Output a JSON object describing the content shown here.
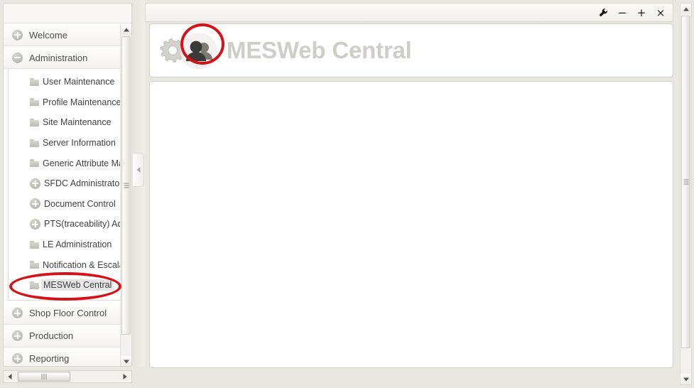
{
  "window": {
    "controls": [
      {
        "name": "wrench-icon",
        "glyph": "⚒"
      },
      {
        "name": "minimize-button",
        "glyph": "−"
      },
      {
        "name": "maximize-button",
        "glyph": "+"
      },
      {
        "name": "close-button",
        "glyph": "×"
      }
    ]
  },
  "header": {
    "title": "MESWeb Central",
    "gear_icon": "gear-icon",
    "users_icon": "users-icon"
  },
  "sidebar": {
    "groups": [
      {
        "label": "Welcome",
        "state": "collapsed",
        "icon": "plus-circle-icon",
        "items": []
      },
      {
        "label": "Administration",
        "state": "expanded",
        "icon": "minus-circle-icon",
        "items": [
          {
            "label": "User Maintenance",
            "icon": "folder-icon",
            "selected": false
          },
          {
            "label": "Profile Maintenance",
            "icon": "folder-icon",
            "selected": false
          },
          {
            "label": "Site Maintenance",
            "icon": "folder-icon",
            "selected": false
          },
          {
            "label": "Server Information",
            "icon": "folder-icon",
            "selected": false
          },
          {
            "label": "Generic Attribute Main",
            "icon": "folder-icon",
            "selected": false
          },
          {
            "label": "SFDC Administrator",
            "icon": "plus-circle-icon",
            "selected": false
          },
          {
            "label": "Document Control",
            "icon": "plus-circle-icon",
            "selected": false
          },
          {
            "label": "PTS(traceability) Admin",
            "icon": "plus-circle-icon",
            "selected": false
          },
          {
            "label": "LE Administration",
            "icon": "folder-icon",
            "selected": false
          },
          {
            "label": "Notification & Escalatio",
            "icon": "folder-icon",
            "selected": false
          },
          {
            "label": "MESWeb Central",
            "icon": "folder-icon",
            "selected": true
          }
        ]
      },
      {
        "label": "Shop Floor Control",
        "state": "collapsed",
        "icon": "plus-circle-icon",
        "items": []
      },
      {
        "label": "Production",
        "state": "collapsed",
        "icon": "plus-circle-icon",
        "items": []
      },
      {
        "label": "Reporting",
        "state": "collapsed",
        "icon": "plus-circle-icon",
        "items": []
      }
    ]
  },
  "annotations": {
    "accent_color": "#d41217",
    "highlights": [
      {
        "target": "users-icon",
        "shape": "ellipse"
      },
      {
        "target": "sidebar-item-mesweb-central",
        "shape": "ellipse"
      }
    ]
  }
}
